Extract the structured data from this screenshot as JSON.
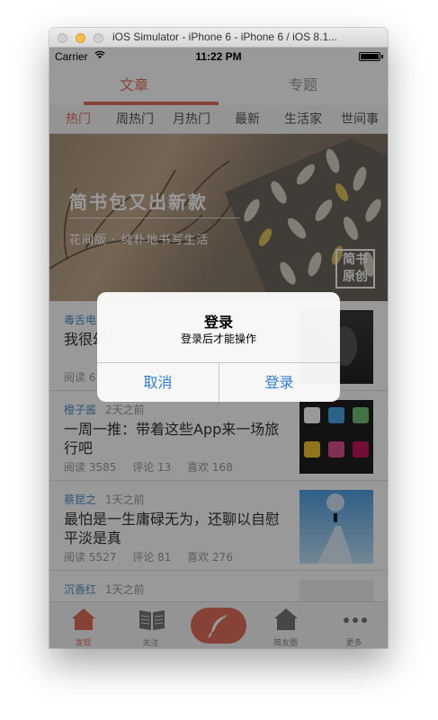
{
  "window": {
    "title": "iOS Simulator - iPhone 6 - iPhone 6 / iOS 8.1..."
  },
  "status_bar": {
    "carrier": "Carrier",
    "time": "11:22 PM"
  },
  "top_tabs": [
    {
      "label": "文章",
      "active": true
    },
    {
      "label": "专题",
      "active": false
    }
  ],
  "categories": [
    {
      "label": "热门",
      "active": true
    },
    {
      "label": "周热门",
      "active": false
    },
    {
      "label": "月热门",
      "active": false
    },
    {
      "label": "最新",
      "active": false
    },
    {
      "label": "生活家",
      "active": false
    },
    {
      "label": "世间事",
      "active": false
    }
  ],
  "banner": {
    "title": "简书包又出新款",
    "subtitle": "花间版 · 纯朴地书写生活",
    "stamp": [
      "简书",
      "原创"
    ]
  },
  "articles": [
    {
      "author": "毒舌电",
      "time": "",
      "title": "我很幻",
      "reads": "阅读 67",
      "comments": "",
      "likes": ""
    },
    {
      "author": "橙子酱",
      "time": "2天之前",
      "title": "一周一推：带着这些App来一场旅行吧",
      "reads": "阅读 3585",
      "comments": "评论 13",
      "likes": "喜欢 168"
    },
    {
      "author": "蔡昆之",
      "time": "1天之前",
      "title": "最怕是一生庸碌无为，还聊以自慰平淡是真",
      "reads": "阅读 5527",
      "comments": "评论 81",
      "likes": "喜欢 276"
    },
    {
      "author": "沉香红",
      "time": "1天之前",
      "title": "",
      "reads": "",
      "comments": "",
      "likes": ""
    }
  ],
  "tab_bar": [
    {
      "label": "发现",
      "icon": "home-icon",
      "active": true
    },
    {
      "label": "关注",
      "icon": "book-icon",
      "active": false
    },
    {
      "label": "",
      "icon": "feather-icon",
      "active": false
    },
    {
      "label": "简友圈",
      "icon": "home-outline-icon",
      "active": false
    },
    {
      "label": "更多",
      "icon": "more-dots-icon",
      "active": false
    }
  ],
  "alert": {
    "title": "登录",
    "message": "登录后才能操作",
    "cancel_label": "取消",
    "confirm_label": "登录"
  },
  "colors": {
    "accent": "#e06e5a",
    "link": "#4a90c2",
    "alert_button": "#2f7cd6"
  }
}
